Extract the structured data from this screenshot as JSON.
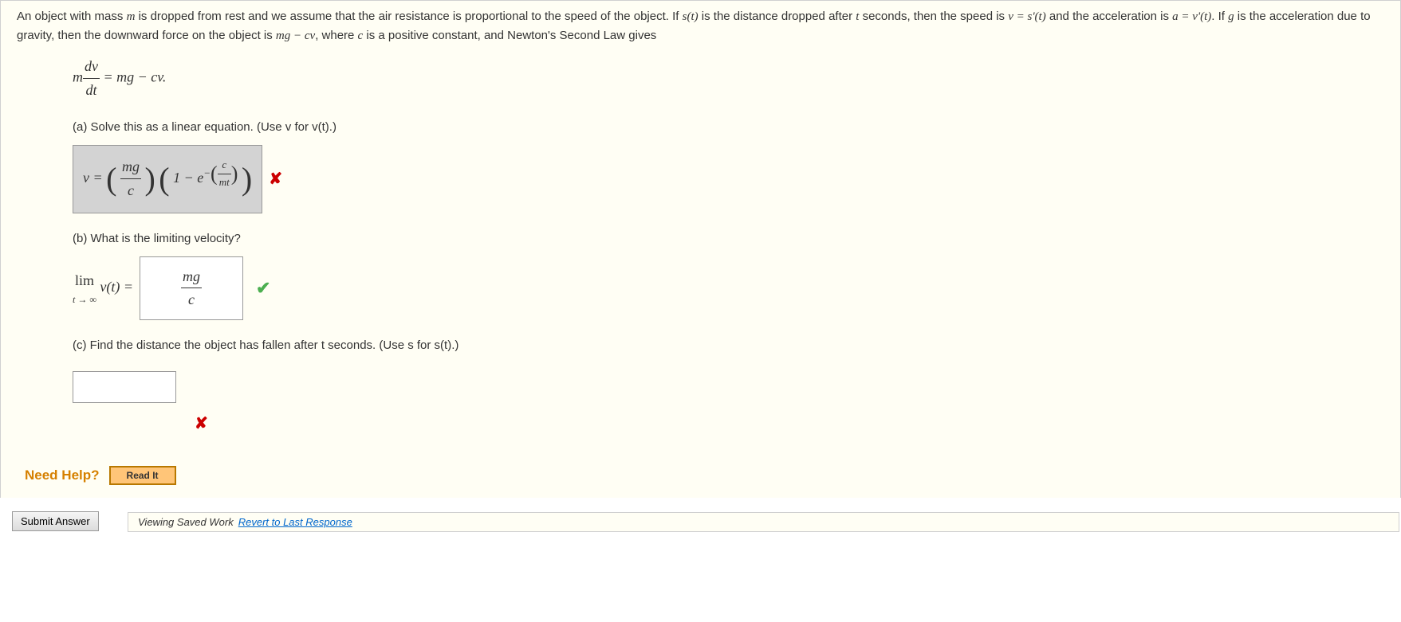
{
  "problem": {
    "intro_part1": "An object with mass ",
    "intro_m": "m",
    "intro_part2": " is dropped from rest and we assume that the air resistance is proportional to the speed of the object. If ",
    "intro_st": "s(t)",
    "intro_part3": "  is the distance dropped after ",
    "intro_t": "t",
    "intro_part4": " seconds, then the speed is  ",
    "intro_v_eq": "v = s'(t)",
    "intro_part5": "  and the acceleration is  ",
    "intro_a_eq": "a = v'(t)",
    "intro_part6": ".  If ",
    "intro_g": "g",
    "intro_part7": " is the acceleration due to gravity, then the downward force on the object is  ",
    "intro_force": "mg − cv",
    "intro_part8": ",  where ",
    "intro_c": "c",
    "intro_part9": " is a positive constant, and Newton's Second Law gives",
    "main_eq_m": "m",
    "main_eq_dv": "dv",
    "main_eq_dt": "dt",
    "main_eq_rhs": " = mg − cv.",
    "part_a": "(a) Solve this as a linear equation. (Use v for v(t).)",
    "part_b": "(b) What is the limiting velocity?",
    "part_c": "(c) Find the distance the object has fallen after t seconds. (Use s for s(t).)"
  },
  "answers": {
    "a_v_eq": "v = ",
    "a_mg": "mg",
    "a_c": "c",
    "a_one_minus_e": "1 − e",
    "a_exp_c": "c",
    "a_exp_mt": "mt",
    "b_lim": "lim",
    "b_sub": "t → ∞",
    "b_vt": "  v(t)  =",
    "b_mg": "mg",
    "b_c": "c"
  },
  "help": {
    "label": "Need Help?",
    "read_it": "Read It"
  },
  "footer": {
    "saved": "Viewing Saved Work ",
    "revert": "Revert to Last Response",
    "submit": "Submit Answer"
  }
}
